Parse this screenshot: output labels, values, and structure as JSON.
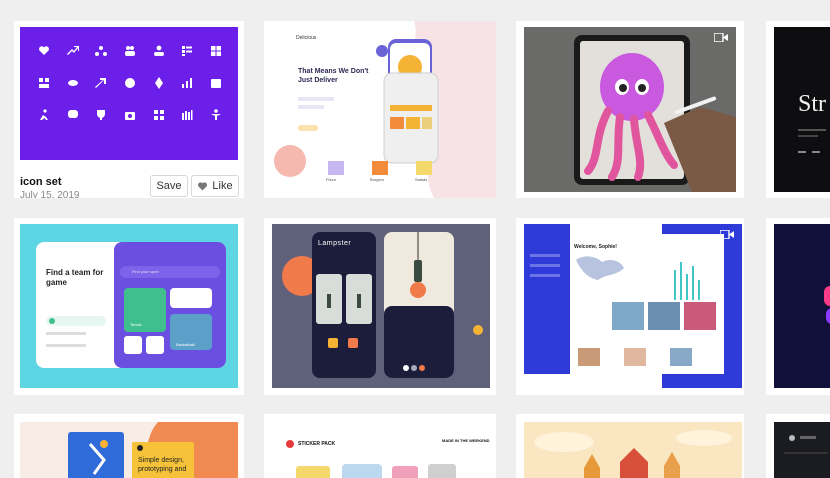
{
  "shots": [
    {
      "title": "icon set",
      "date": "July 15, 2019",
      "actions": {
        "save": "Save",
        "like": "Like"
      },
      "icons": [
        "heart-hand-icon",
        "growth-arrow-icon",
        "network-icon",
        "people-icon",
        "team-icon",
        "list-icon",
        "puzzle-icon",
        "grid-icon",
        "coins-icon",
        "arrow-up-icon",
        "target-icon",
        "rocket-icon",
        "chart-icon",
        "calendar-icon",
        "run-icon",
        "chat-icon",
        "trophy-icon",
        "camera-icon",
        "apps-icon",
        "bars-icon",
        "person-icon"
      ],
      "accent": "#6c1fe8"
    },
    {
      "brand": "Delicious",
      "headline": "That Means We Don't Just Deliver",
      "categories": [
        "Pizza",
        "Burgers",
        "Salads"
      ],
      "accent": "#f5b335"
    },
    {
      "kind": "video",
      "subject": "octopus-illustration-on-tablet"
    },
    {
      "display_text": "Str"
    },
    {
      "headline": "Find a team for game",
      "search_placeholder": "Find your sport",
      "sports": [
        "Tennis",
        "Basketball"
      ],
      "accent": "#6b4fe0"
    },
    {
      "brand": "Lampster"
    },
    {
      "kind": "video",
      "greeting": "Welcome, Sophie!",
      "accent": "#2f3bd9"
    },
    {
      "accent": "#1b1b6b"
    },
    {
      "headline": "Simple design, prototyping and",
      "accent": "#f08a50"
    },
    {
      "header": "STICKER PACK",
      "tagline": "MADE IN THE WEEKEND"
    },
    {
      "subject": "sunset-city-illustration"
    },
    {
      "subject": "dark-dashboard"
    }
  ]
}
